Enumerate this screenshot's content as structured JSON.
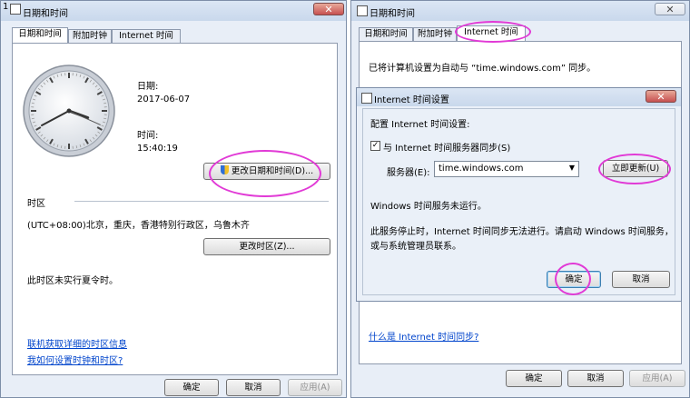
{
  "left_window": {
    "corner_label": "1",
    "title": "日期和时间",
    "close_label": "✕",
    "tabs": [
      "日期和时间",
      "附加时钟",
      "Internet 时间"
    ],
    "date_label": "日期:",
    "date_value": "2017-06-07",
    "time_label": "时间:",
    "time_value": "15:40:19",
    "change_date_time_button": "更改日期和时间(D)...",
    "timezone_header": "时区",
    "timezone_value": "(UTC+08:00)北京，重庆，香港特别行政区，乌鲁木齐",
    "change_timezone_button": "更改时区(Z)...",
    "dst_note": "此时区未实行夏令时。",
    "links": [
      "联机获取详细的时区信息",
      "我如何设置时钟和时区?"
    ],
    "ok_button": "确定",
    "cancel_button": "取消",
    "apply_button": "应用(A)",
    "clock": {
      "hour": 3,
      "minute": 40,
      "second": 19
    }
  },
  "right_window": {
    "title": "日期和时间",
    "close_label": "✕",
    "tabs": [
      "日期和时间",
      "附加时钟",
      "Internet 时间"
    ],
    "sync_status": "已将计算机设置为自动与 “time.windows.com” 同步。",
    "link": "什么是 Internet 时间同步?",
    "ok_button": "确定",
    "cancel_button": "取消",
    "apply_button": "应用(A)"
  },
  "dialog": {
    "title": "Internet 时间设置",
    "close_label": "✕",
    "config_label": "配置 Internet 时间设置:",
    "sync_checkbox_label": "与 Internet 时间服务器同步(S)",
    "sync_checked": true,
    "server_label": "服务器(E):",
    "server_value": "time.windows.com",
    "update_button": "立即更新(U)",
    "service_status": "Windows 时间服务未运行。",
    "service_note_line1": "此服务停止时，Internet 时间同步无法进行。请启动 Windows 时间服务，",
    "service_note_line2": "或与系统管理员联系。",
    "ok_button": "确定",
    "cancel_button": "取消"
  },
  "colors": {
    "highlight_circle": "#e13ad6",
    "link": "#0044cc",
    "title_bar": "#c9d8ec"
  }
}
